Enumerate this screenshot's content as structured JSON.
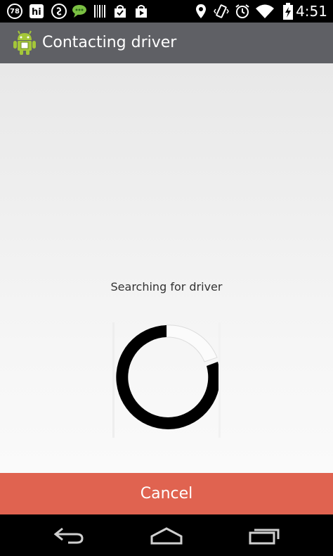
{
  "status_bar": {
    "time": "4:51",
    "notification_badge": "78",
    "icons_left": [
      "notification-count-icon",
      "hi-app-icon",
      "shazam-icon",
      "chat-icon",
      "barcode-icon",
      "shopping-bag-icon",
      "play-store-icon"
    ],
    "icons_right": [
      "location-icon",
      "vibrate-icon",
      "alarm-icon",
      "wifi-icon",
      "battery-charging-icon"
    ]
  },
  "action_bar": {
    "title": "Contacting driver",
    "icon": "android-app-icon"
  },
  "main": {
    "status_text": "Searching for driver",
    "spinner": "progress-spinner-icon"
  },
  "cancel": {
    "label": "Cancel",
    "color": "#e06350"
  },
  "nav_bar": {
    "buttons": [
      "back-icon",
      "home-icon",
      "recent-apps-icon"
    ]
  }
}
